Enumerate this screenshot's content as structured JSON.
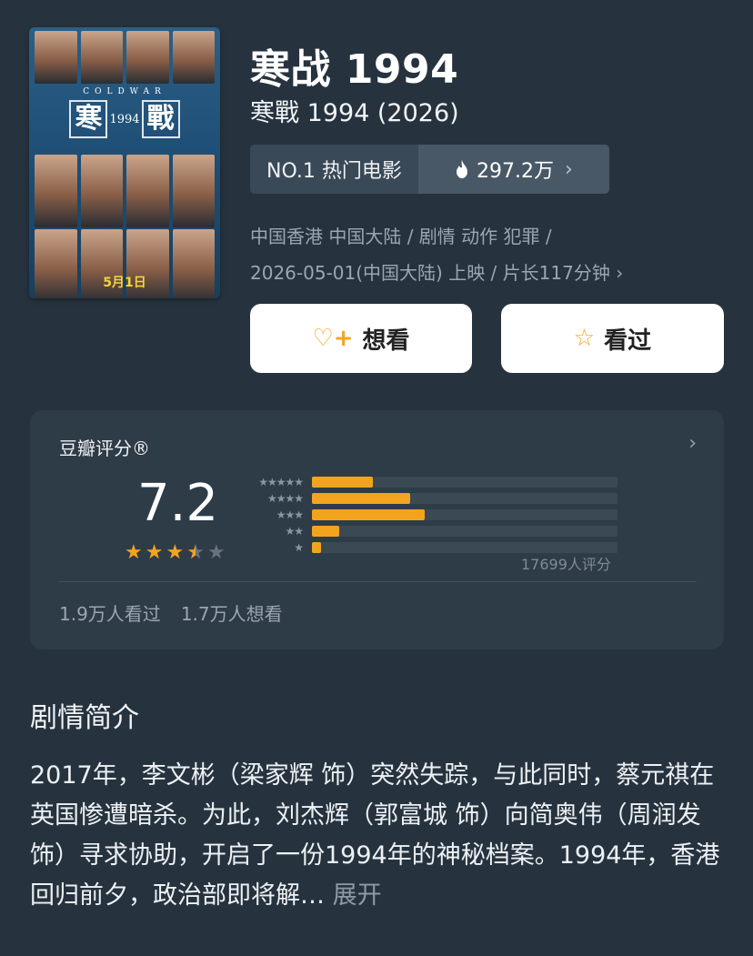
{
  "poster": {
    "coldwar": "COLDWAR",
    "char1": "寒",
    "num": "1994",
    "char2": "戰",
    "date": "5月1日"
  },
  "title": "寒战 1994",
  "subtitle": "寒戰 1994 (2026)",
  "rank": {
    "label": "NO.1 热门电影",
    "heat": "297.2万",
    "flame_icon": "flame-icon",
    "chevron_icon": "chevron-right-icon"
  },
  "meta": {
    "line1": "中国香港 中国大陆 / 剧情 动作 犯罪 /",
    "line2": "2026-05-01(中国大陆) 上映 / 片长117分钟"
  },
  "buttons": {
    "want": "想看",
    "seen": "看过"
  },
  "rating": {
    "label": "豆瓣评分®",
    "score": "7.2",
    "stars": 3.5,
    "count_text": "17699人评分",
    "distribution": [
      {
        "stars": 5,
        "fraction": 0.2
      },
      {
        "stars": 4,
        "fraction": 0.32
      },
      {
        "stars": 3,
        "fraction": 0.37
      },
      {
        "stars": 2,
        "fraction": 0.09
      },
      {
        "stars": 1,
        "fraction": 0.03
      }
    ],
    "watched": "1.9万人看过",
    "wish": "1.7万人想看"
  },
  "synopsis": {
    "heading": "剧情简介",
    "text": "2017年，李文彬（梁家辉 饰）突然失踪，与此同时，蔡元祺在英国惨遭暗杀。为此，刘杰辉（郭富城 饰）向简奥伟（周润发 饰）寻求协助，开启了一份1994年的神秘档案。1994年，香港回归前夕，政治部即将解…",
    "more": "展开"
  },
  "colors": {
    "background": "#26333f",
    "accent": "#f3a41f"
  }
}
